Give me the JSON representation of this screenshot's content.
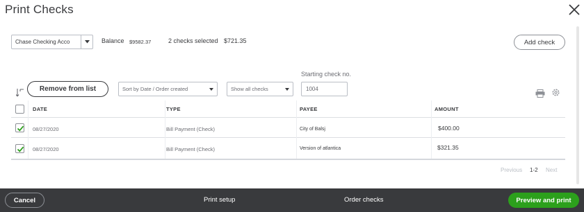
{
  "window": {
    "title": "Print Checks",
    "close_icon": "close-icon"
  },
  "toolbar": {
    "account_value": "Chase Checking Acco",
    "balance_label": "Balance",
    "balance_value": "$9582.37",
    "selected_text": "2 checks selected",
    "selected_amount": "$721.35",
    "add_check_label": "Add check"
  },
  "filters": {
    "remove_label": "Remove from list",
    "sort_value": "Sort by Date / Order created",
    "show_value": "Show all checks",
    "start_label": "Starting check no.",
    "start_value": "1004"
  },
  "icons": {
    "sort": "sort-icon",
    "print": "print-icon",
    "settings": "gear-icon",
    "dropdown": "chevron-down-icon"
  },
  "table": {
    "columns": [
      "DATE",
      "TYPE",
      "PAYEE",
      "AMOUNT"
    ],
    "rows": [
      {
        "checked": true,
        "date": "08/27/2020",
        "type": "Bill Payment (Check)",
        "payee": "City of Balsj",
        "amount": "$400.00"
      },
      {
        "checked": true,
        "date": "08/27/2020",
        "type": "Bill Payment (Check)",
        "payee": "Version of atlantica",
        "amount": "$321.35"
      }
    ]
  },
  "pager": {
    "previous": "Previous",
    "range": "1-2",
    "next": "Next"
  },
  "footer": {
    "cancel_label": "Cancel",
    "print_setup_label": "Print setup",
    "order_checks_label": "Order checks",
    "preview_label": "Preview and print"
  },
  "colors": {
    "accent_green": "#2ca01c",
    "footer_bg": "#393a3d",
    "checkmark": "#2ca01c"
  }
}
